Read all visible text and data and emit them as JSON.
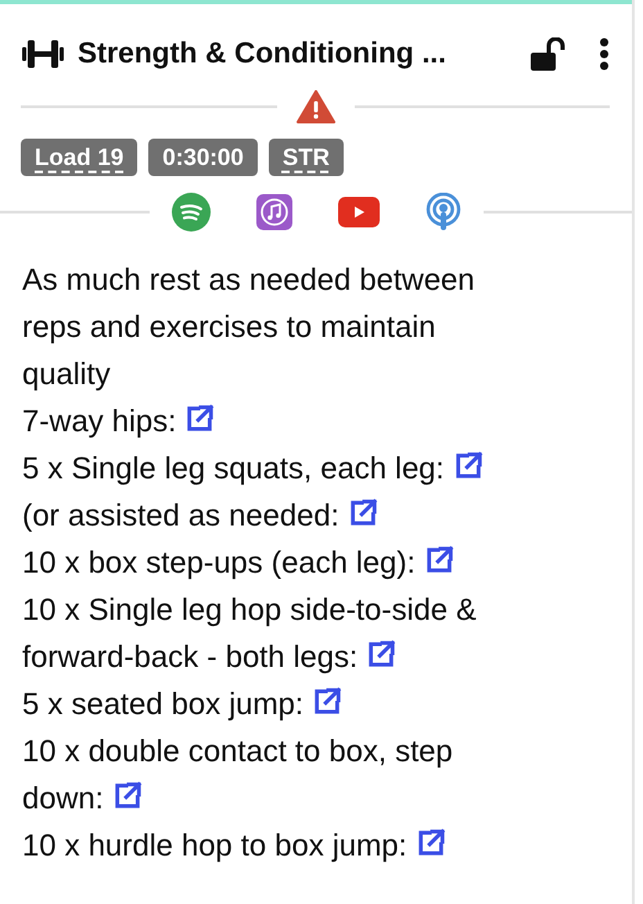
{
  "header": {
    "title": "Strength & Conditioning ...",
    "locked": false
  },
  "warning": true,
  "tags": [
    {
      "label": "Load 19",
      "hint": true
    },
    {
      "label": "0:30:00",
      "hint": false
    },
    {
      "label": "STR",
      "hint": true
    }
  ],
  "media": [
    {
      "kind": "spotify"
    },
    {
      "kind": "music"
    },
    {
      "kind": "youtube"
    },
    {
      "kind": "podcast"
    }
  ],
  "description": "As much rest as needed between reps and exercises to maintain quality",
  "exercises": [
    {
      "text": "7-way hips:"
    },
    {
      "text": "5 x Single leg squats, each leg:"
    },
    {
      "text": "(or assisted as needed:"
    },
    {
      "text": "10 x box step-ups (each leg):"
    },
    {
      "text": "10 x Single leg hop side-to-side & forward-back - both legs:"
    },
    {
      "text": "5 x seated box jump:"
    },
    {
      "text": "10 x double contact to box, step down:"
    },
    {
      "text": "10 x hurdle hop to box jump:"
    }
  ]
}
